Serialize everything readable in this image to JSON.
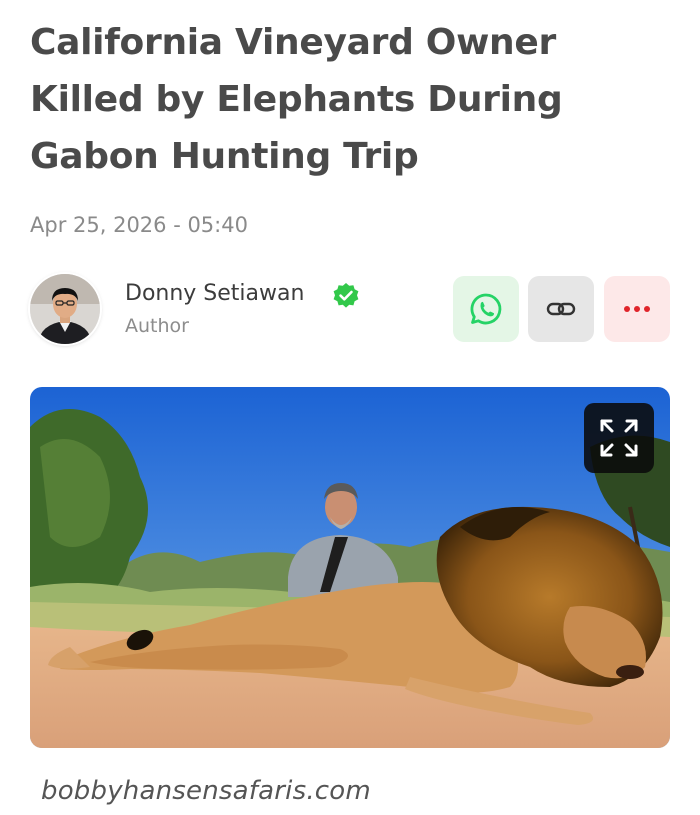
{
  "article": {
    "headline": "California Vineyard Owner Killed by Elephants During Gabon Hunting Trip",
    "date": "Apr 25, 2026 - 05:40"
  },
  "author": {
    "name": "Donny Setiawan",
    "role": "Author",
    "verified": true
  },
  "share": {
    "buttons": [
      {
        "icon": "whatsapp-icon",
        "color": "#25d366",
        "background": "#e4f6e6"
      },
      {
        "icon": "link-icon",
        "color": "#333333",
        "background": "#e6e6e6"
      },
      {
        "icon": "more-icon",
        "color": "#e0242a",
        "background": "#fde8e8"
      }
    ]
  },
  "image": {
    "expand_icon": "expand-icon",
    "source_caption": "bobbyhansensafaris.com"
  },
  "colors": {
    "headline": "#4a4a4a",
    "meta": "#8a8a8a",
    "verified": "#32c84a"
  }
}
